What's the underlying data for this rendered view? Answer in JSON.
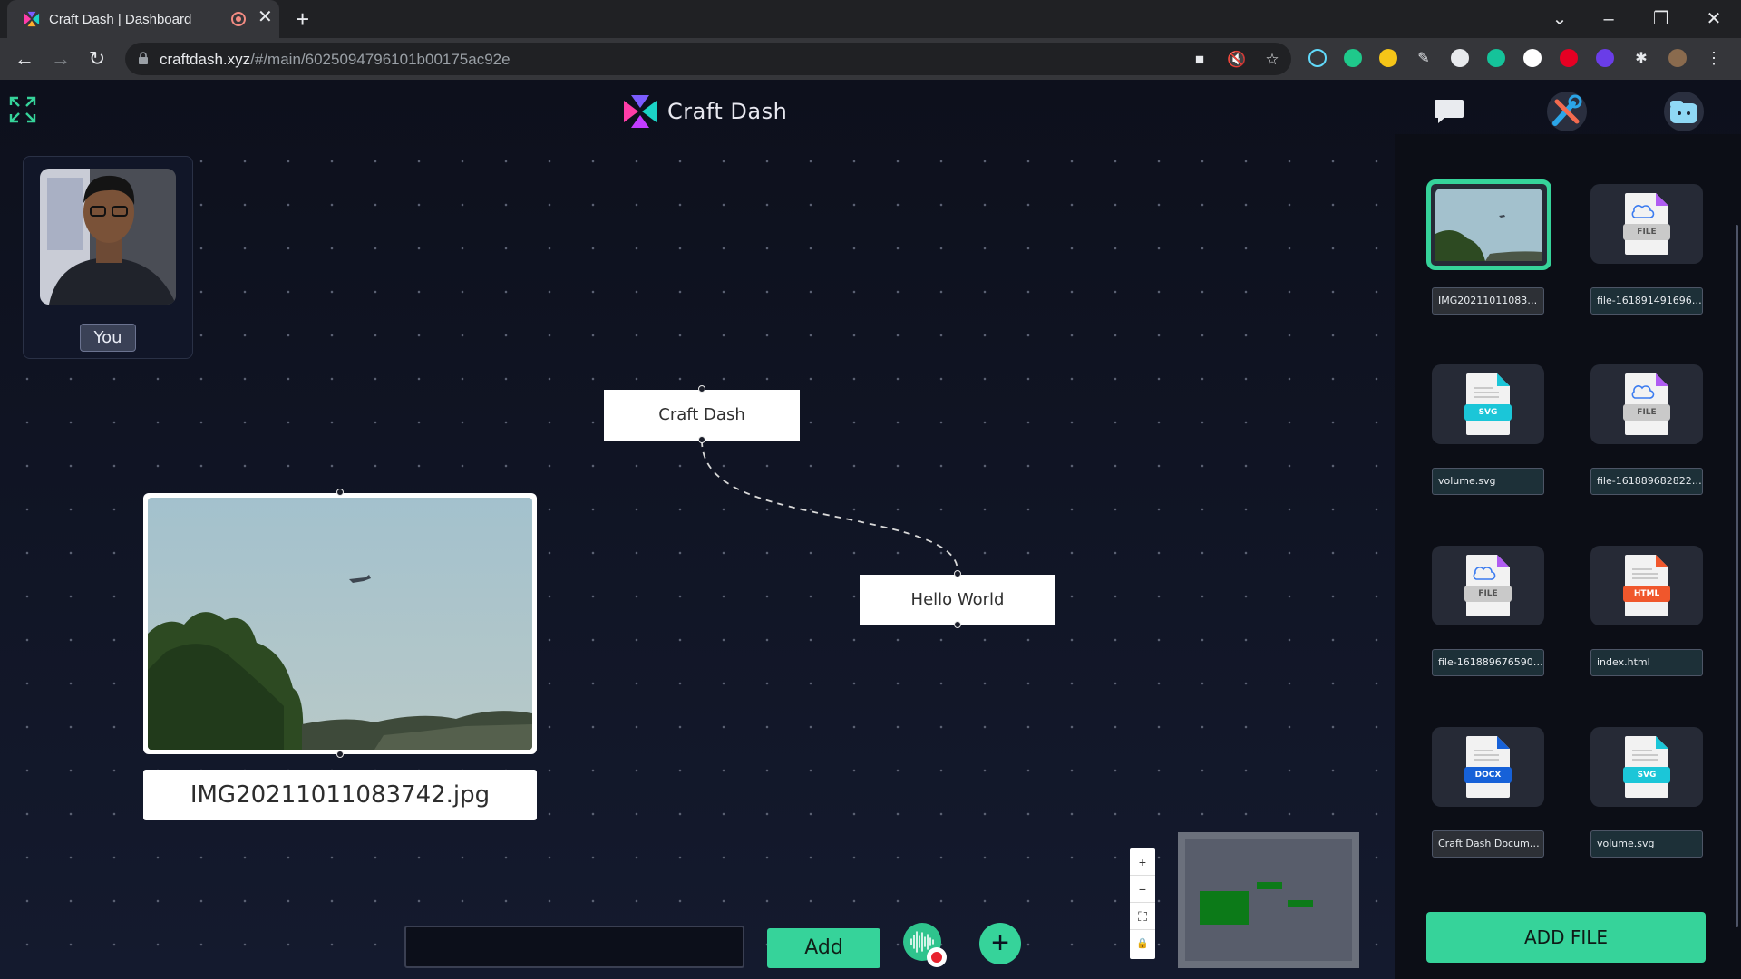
{
  "browser": {
    "tab_title": "Craft Dash | Dashboard",
    "url_host": "craftdash.xyz",
    "url_path": "/#/main/6025094796101b00175ac92e"
  },
  "app": {
    "brand_name": "Craft Dash",
    "video": {
      "label": "You"
    },
    "nodes": [
      {
        "label": "Craft Dash"
      },
      {
        "label": "Hello World"
      }
    ],
    "image_node": {
      "caption": "IMG20211011083742.jpg"
    },
    "bottom_bar": {
      "input_value": "",
      "add_label": "Add"
    },
    "zoom": {
      "in": "+",
      "out": "−",
      "fit": "⛶",
      "lock": "🔒"
    }
  },
  "panel": {
    "files": [
      {
        "name": "IMG20211011083742.jpg",
        "type": "image",
        "selected": true
      },
      {
        "name": "file-1618914916960.m...",
        "type": "FILE"
      },
      {
        "name": "volume.svg",
        "type": "SVG"
      },
      {
        "name": "file-1618896828225...",
        "type": "FILE"
      },
      {
        "name": "file-1618896765906...",
        "type": "FILE"
      },
      {
        "name": "index.html",
        "type": "HTML"
      },
      {
        "name": "Craft Dash Docume...",
        "type": "DOCX"
      },
      {
        "name": "volume.svg",
        "type": "SVG"
      }
    ],
    "add_file_label": "ADD FILE"
  },
  "colors": {
    "accent": "#36d39a",
    "svg": "#1bc6d8",
    "html": "#f0572c",
    "docx": "#1661d8",
    "file": "#c9c9c9"
  }
}
